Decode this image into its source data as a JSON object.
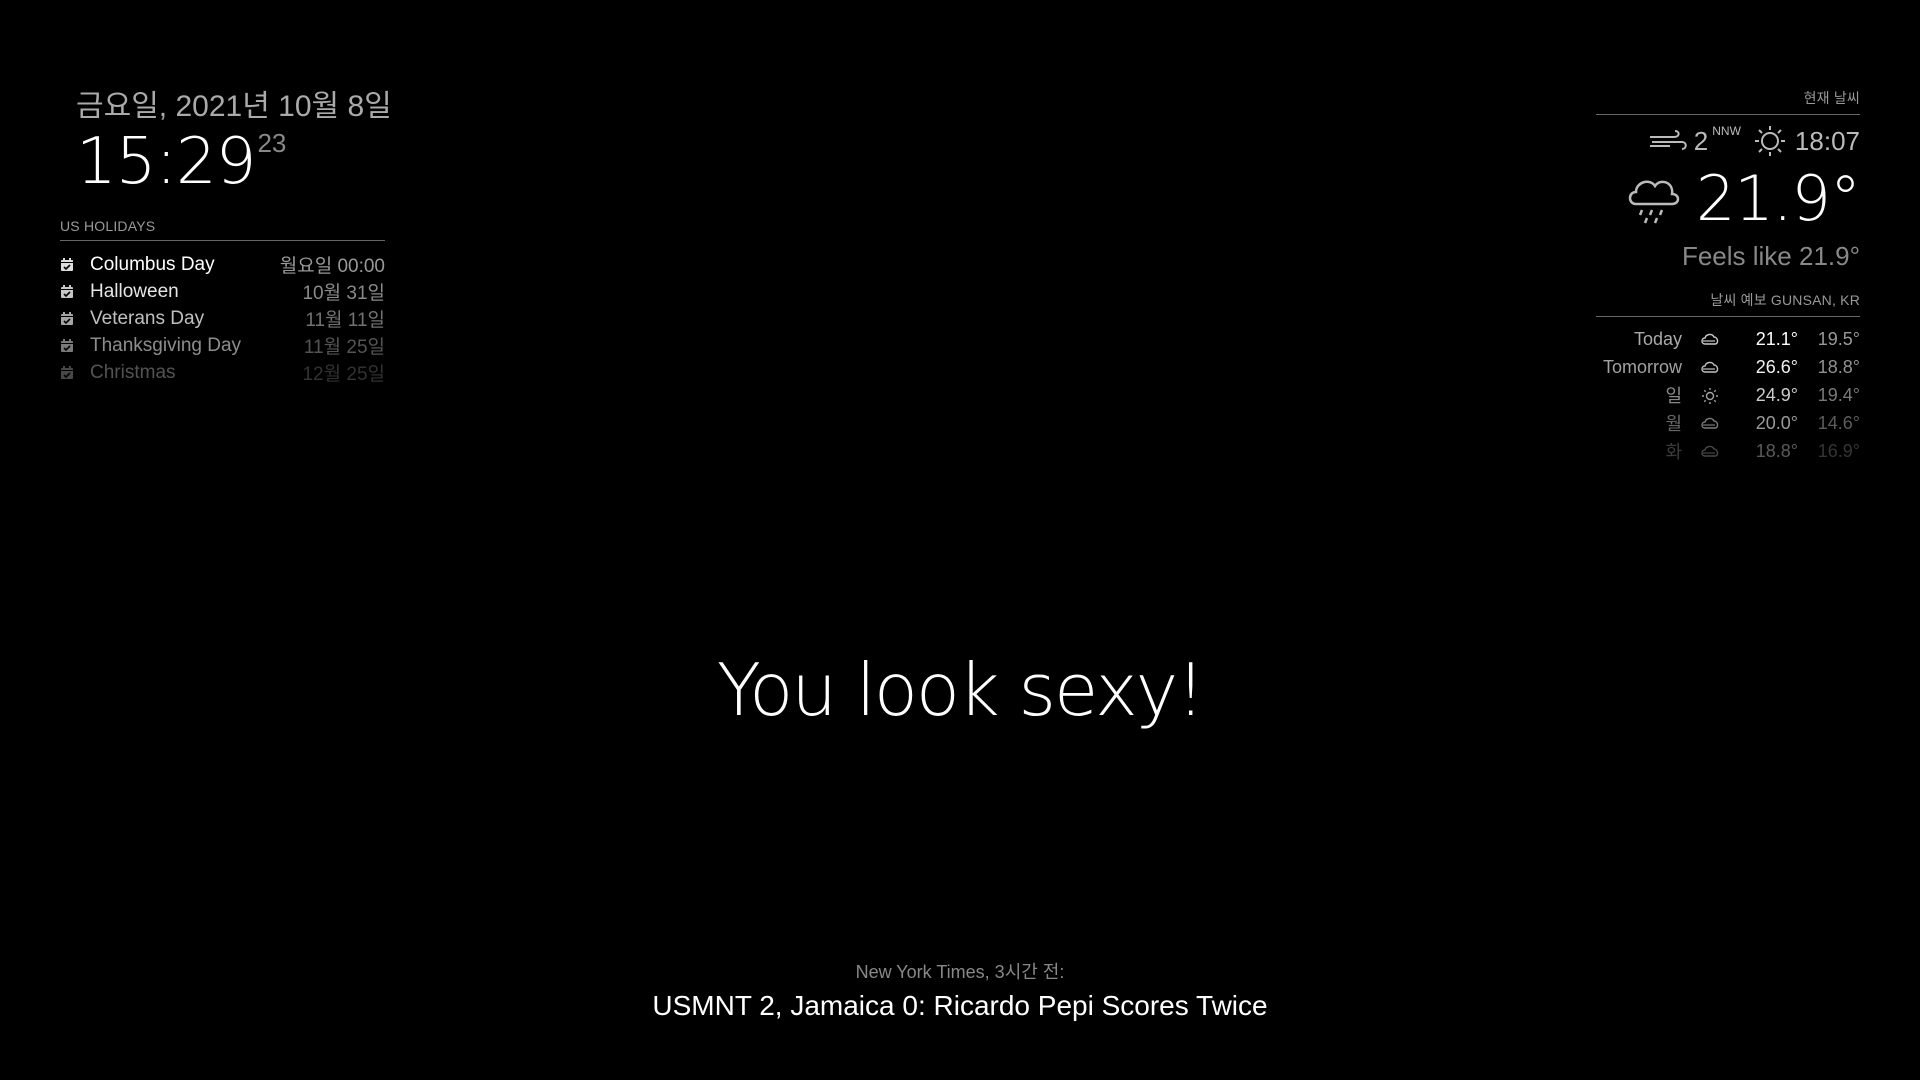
{
  "clock": {
    "date": "금요일, 2021년 10월 8일",
    "time": "15:29",
    "seconds": "23"
  },
  "calendar": {
    "header": "US HOLIDAYS",
    "events": [
      {
        "title": "Columbus Day",
        "time": "월요일 00:00",
        "icon": "calendar-check-icon"
      },
      {
        "title": "Halloween",
        "time": "10월 31일",
        "icon": "calendar-check-icon"
      },
      {
        "title": "Veterans Day",
        "time": "11월 11일",
        "icon": "calendar-check-icon"
      },
      {
        "title": "Thanksgiving Day",
        "time": "11월 25일",
        "icon": "calendar-check-icon"
      },
      {
        "title": "Christmas",
        "time": "12월 25일",
        "icon": "calendar-check-icon"
      }
    ]
  },
  "current_weather": {
    "header": "현재 날씨",
    "wind_speed": "2",
    "wind_direction": "NNW",
    "sunset_time": "18:07",
    "temperature": "21.9°",
    "feels_like": "Feels like 21.9°",
    "condition_icon": "rain-cloud-icon"
  },
  "forecast": {
    "header": "날씨 예보 GUNSAN, KR",
    "days": [
      {
        "day": "Today",
        "icon": "cloudy-icon",
        "max": "21.1°",
        "min": "19.5°"
      },
      {
        "day": "Tomorrow",
        "icon": "cloudy-icon",
        "max": "26.6°",
        "min": "18.8°"
      },
      {
        "day": "일",
        "icon": "sun-icon",
        "max": "24.9°",
        "min": "19.4°"
      },
      {
        "day": "월",
        "icon": "cloudy-icon",
        "max": "20.0°",
        "min": "14.6°"
      },
      {
        "day": "화",
        "icon": "cloudy-icon",
        "max": "18.8°",
        "min": "16.9°"
      }
    ]
  },
  "compliment": "You look sexy!",
  "news": {
    "source": "New York Times, 3시간 전:",
    "title": "USMNT 2, Jamaica 0: Ricardo Pepi Scores Twice"
  },
  "colors": {
    "background": "#000000",
    "text_bright": "#ffffff",
    "text_dim": "#999999"
  }
}
